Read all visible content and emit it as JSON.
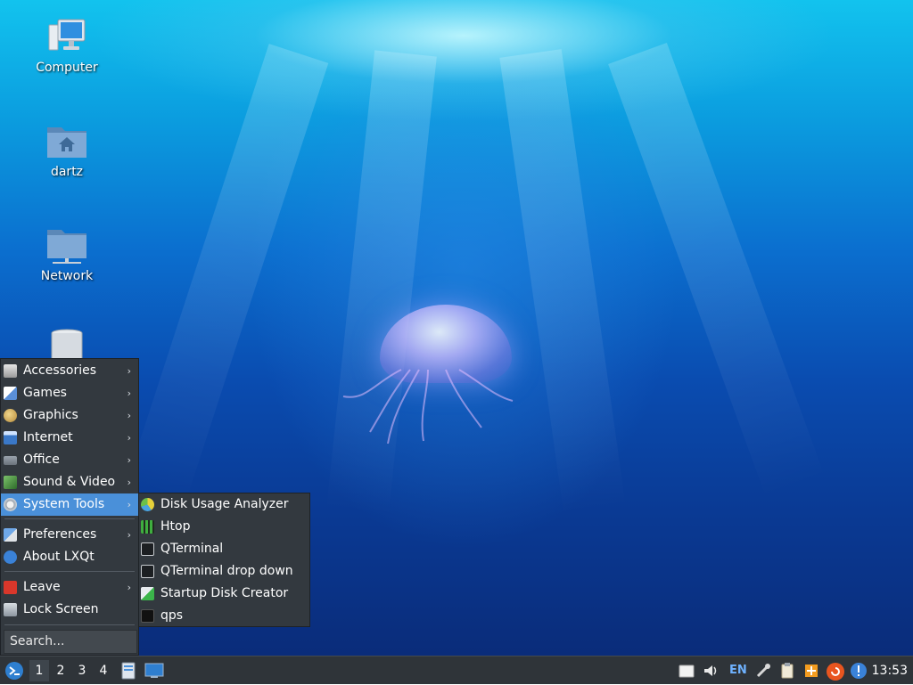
{
  "desktop": {
    "icons": [
      {
        "label": "Computer",
        "icon": "computer-icon"
      },
      {
        "label": "dartz",
        "icon": "home-folder-icon"
      },
      {
        "label": "Network",
        "icon": "network-folder-icon"
      },
      {
        "label": "",
        "icon": "trash-icon"
      }
    ]
  },
  "menu": {
    "items": [
      {
        "label": "Accessories",
        "icon": "accessories-icon",
        "submenu": true
      },
      {
        "label": "Games",
        "icon": "games-icon",
        "submenu": true
      },
      {
        "label": "Graphics",
        "icon": "graphics-icon",
        "submenu": true
      },
      {
        "label": "Internet",
        "icon": "internet-icon",
        "submenu": true
      },
      {
        "label": "Office",
        "icon": "office-icon",
        "submenu": true
      },
      {
        "label": "Sound & Video",
        "icon": "sound-video-icon",
        "submenu": true
      },
      {
        "label": "System Tools",
        "icon": "system-tools-icon",
        "submenu": true,
        "active": true
      },
      {
        "label": "Preferences",
        "icon": "preferences-icon",
        "submenu": true
      },
      {
        "label": "About LXQt",
        "icon": "about-icon",
        "submenu": false
      },
      {
        "label": "Leave",
        "icon": "leave-icon",
        "submenu": true
      },
      {
        "label": "Lock Screen",
        "icon": "lock-screen-icon",
        "submenu": false
      }
    ],
    "arrow": "›",
    "search_placeholder": "Search..."
  },
  "submenu": {
    "items": [
      {
        "label": "Disk Usage Analyzer",
        "icon": "disk-usage-icon"
      },
      {
        "label": "Htop",
        "icon": "htop-icon"
      },
      {
        "label": "QTerminal",
        "icon": "terminal-icon"
      },
      {
        "label": "QTerminal drop down",
        "icon": "terminal-dropdown-icon"
      },
      {
        "label": "Startup Disk Creator",
        "icon": "startup-disk-icon"
      },
      {
        "label": "qps",
        "icon": "qps-icon"
      }
    ]
  },
  "taskbar": {
    "workspaces": [
      "1",
      "2",
      "3",
      "4"
    ],
    "active_workspace": "1",
    "language": "EN",
    "clock": "13:53"
  },
  "colors": {
    "menu_bg": "#33393f",
    "highlight": "#4a90d9",
    "taskbar_bg": "#2f3439"
  }
}
